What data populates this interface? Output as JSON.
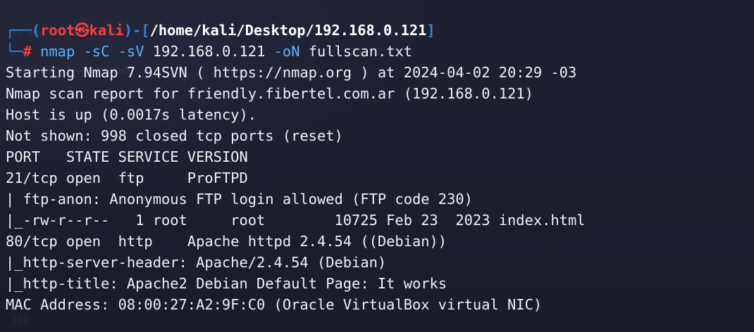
{
  "background_hints": [
    "92 Hy8nvLF8HVjqKCYX",
    "93 0VB5pA3jaJaQ9xmWN",
    "",
    "",
    "",
    "",
    "",
    "",
    "",
    "",
    "",
    "",
    "",
    "",
    "",
    "",
    "",
    "",
    "",
    "",
    "",
    "",
    "",
    "",
    "112"
  ],
  "prompt": {
    "open_corner": "┌──",
    "open_paren": "(",
    "user": "root",
    "skull": "㉿",
    "host": "kali",
    "close_paren": ")",
    "dash": "-",
    "open_bracket": "[",
    "path": "/home/kali/Desktop/192.168.0.121",
    "close_bracket": "]",
    "close_corner": "└─",
    "hash": "#",
    "command": {
      "name": "nmap",
      "flag1": "-sC",
      "flag2": "-sV",
      "target": "192.168.0.121",
      "flag3": "-oN",
      "file": "fullscan.txt"
    }
  },
  "output": [
    "Starting Nmap 7.94SVN ( https://nmap.org ) at 2024-04-02 20:29 -03",
    "Nmap scan report for friendly.fibertel.com.ar (192.168.0.121)",
    "Host is up (0.0017s latency).",
    "Not shown: 998 closed tcp ports (reset)",
    "PORT   STATE SERVICE VERSION",
    "21/tcp open  ftp     ProFTPD",
    "| ftp-anon: Anonymous FTP login allowed (FTP code 230)",
    "|_-rw-r--r--   1 root     root        10725 Feb 23  2023 index.html",
    "80/tcp open  http    Apache httpd 2.4.54 ((Debian))",
    "|_http-server-header: Apache/2.4.54 (Debian)",
    "|_http-title: Apache2 Debian Default Page: It works",
    "MAC Address: 08:00:27:A2:9F:C0 (Oracle VirtualBox virtual NIC)"
  ]
}
